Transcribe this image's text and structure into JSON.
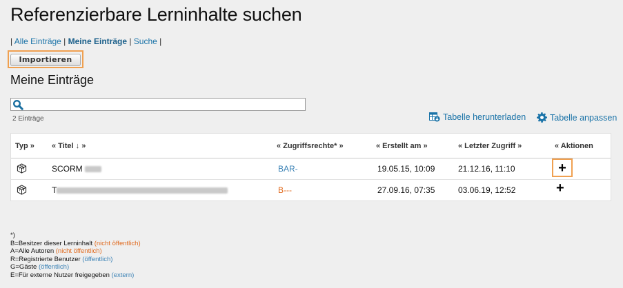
{
  "page": {
    "title": "Referenzierbare Lerninhalte suchen"
  },
  "nav": {
    "sep_start": "| ",
    "items": [
      {
        "label": "Alle Einträge"
      },
      {
        "label": "Meine Einträge"
      },
      {
        "label": "Suche"
      }
    ],
    "sep": " | ",
    "sep_end": " |"
  },
  "import_button": {
    "label": "Importieren"
  },
  "section": {
    "title": "Meine Einträge"
  },
  "search": {
    "placeholder": ""
  },
  "count": "2 Einträge",
  "tools": {
    "download": "Tabelle herunterladen",
    "adjust": "Tabelle anpassen"
  },
  "table": {
    "headers": [
      "Typ »",
      "« Titel ↓ »",
      "« Zugriffsrechte* »",
      "« Erstellt am »",
      "« Letzter Zugriff »",
      "« Aktionen"
    ],
    "rows": [
      {
        "title": "SCORM",
        "access": "BAR-",
        "created": "19.05.15, 10:09",
        "last": "21.12.16, 11:10",
        "action": "+"
      },
      {
        "title": "T",
        "access": "B---",
        "created": "27.09.16, 07:35",
        "last": "03.06.19, 12:52",
        "action": "+"
      }
    ]
  },
  "legend": {
    "star": "*)",
    "lines": [
      {
        "text": "B=Besitzer dieser Lerninhalt ",
        "note": "(nicht öffentlich)",
        "kind": "npub"
      },
      {
        "text": "A=Alle Autoren ",
        "note": "(nicht öffentlich)",
        "kind": "npub"
      },
      {
        "text": "R=Registrierte Benutzer ",
        "note": "(öffentlich)",
        "kind": "pub"
      },
      {
        "text": "G=Gäste ",
        "note": "(öffentlich)",
        "kind": "pub"
      },
      {
        "text": "E=Für externe Nutzer freigegeben ",
        "note": "(extern)",
        "kind": "pub"
      }
    ]
  },
  "colors": {
    "accent_link": "#1a73a8",
    "highlight": "#f0a050",
    "public": "#3b82b5",
    "not_public": "#e06a1e"
  }
}
